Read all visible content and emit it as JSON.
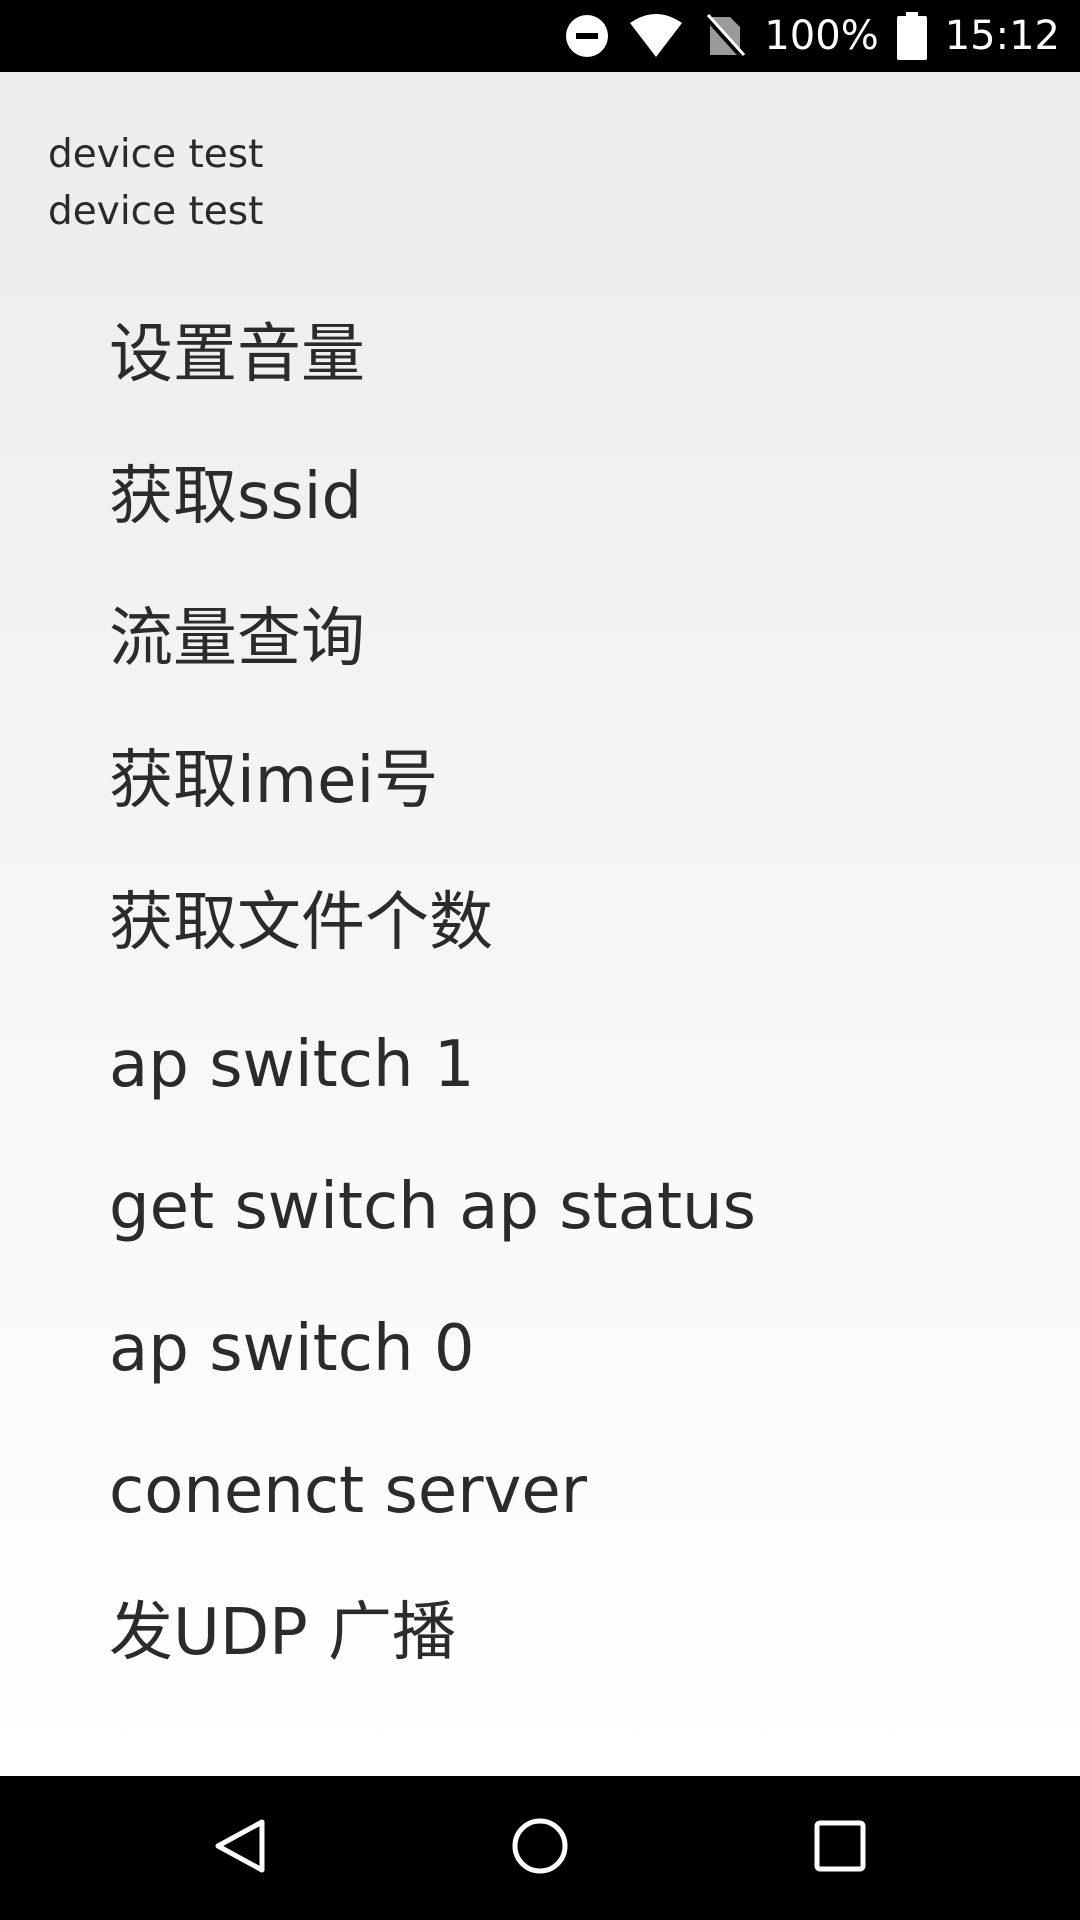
{
  "status_bar": {
    "battery_percent": "100%",
    "time": "15:12",
    "icons": [
      "do-not-disturb-icon",
      "wifi-icon",
      "no-sim-icon",
      "battery-icon"
    ]
  },
  "header": {
    "line1": "device test",
    "line2": "device test"
  },
  "menu": {
    "items": [
      {
        "label": "设置音量"
      },
      {
        "label": "获取ssid"
      },
      {
        "label": "流量查询"
      },
      {
        "label": "获取imei号"
      },
      {
        "label": "获取文件个数"
      },
      {
        "label": "ap switch 1"
      },
      {
        "label": "get switch ap status"
      },
      {
        "label": "ap switch 0"
      },
      {
        "label": "conenct server"
      },
      {
        "label": "发UDP 广播"
      }
    ]
  },
  "nav_bar": {
    "icons": [
      "back-icon",
      "home-icon",
      "recents-icon"
    ]
  },
  "colors": {
    "status_bar_bg": "#000000",
    "nav_bar_bg": "#000000",
    "text": "#2b2b2b",
    "background_top": "#ececec",
    "background_bottom": "#ffffff"
  }
}
